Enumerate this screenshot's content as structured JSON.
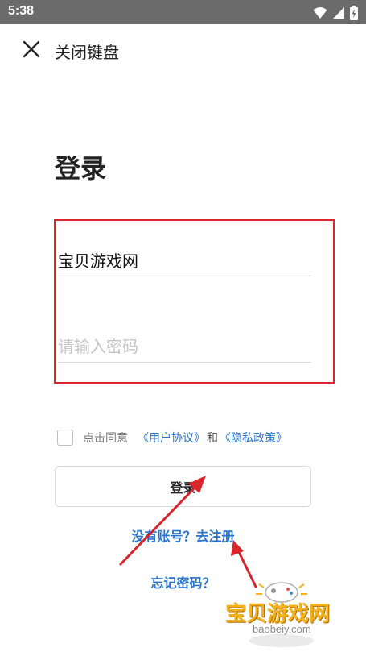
{
  "status_bar": {
    "time": "5:38"
  },
  "top_bar": {
    "close_label": "关闭键盘"
  },
  "title": "登录",
  "form": {
    "username_value": "宝贝游戏网",
    "password_placeholder": "请输入密码"
  },
  "agreement": {
    "prefix": "点击同意",
    "user_agreement": "《用户协议》",
    "and": "和",
    "privacy_policy": "《隐私政策》"
  },
  "login_button": "登录",
  "register_link": "没有账号？去注册",
  "forgot_link": "忘记密码？",
  "watermark": {
    "name": "宝贝游戏网",
    "domain": "baobeiy.com"
  },
  "colors": {
    "link": "#2a74c9",
    "highlight": "#d9252b",
    "annotation_arrow": "#d9252b"
  }
}
